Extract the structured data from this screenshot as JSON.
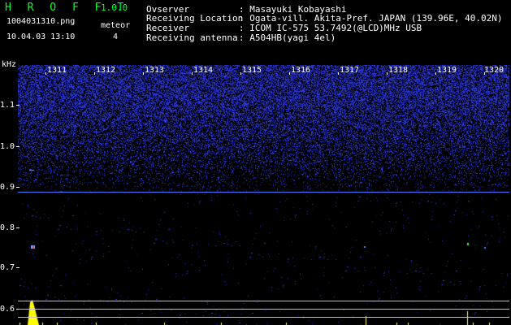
{
  "app": {
    "title": "H R O F F T",
    "version": "1.0.0"
  },
  "file": {
    "name": "1004031310.png",
    "datetime": "10.04.03 13:10"
  },
  "meteor": {
    "label": "meteor",
    "count": "4"
  },
  "info": [
    {
      "key": "Ovserver",
      "value": ": Masayuki Kobayashi"
    },
    {
      "key": "Receiving Location",
      "value": ": Ogata-vill. Akita-Pref. JAPAN (139.96E, 40.02N)"
    },
    {
      "key": "Receiver",
      "value": ": ICOM IC-575 53.7492(@LCD)MHz USB"
    },
    {
      "key": "Receiving antenna",
      "value": ": A504HB(yagi 4el)"
    }
  ],
  "y_axis": {
    "unit": "kHz",
    "ticks": [
      "1.1",
      "1.0",
      "0.9",
      "0.8",
      "0.7",
      "0.6"
    ]
  },
  "x_axis": {
    "ticks": [
      "1311",
      "1312",
      "1313",
      "1314",
      "1315",
      "1316",
      "1317",
      "1318",
      "1319",
      "1320"
    ]
  },
  "colors": {
    "text_green": "#00ff2a",
    "text_white": "#ffffff",
    "noise_blue": "#2a3cff",
    "line_blue": "#3f7cff",
    "meteor_yellow": "#ffff00"
  }
}
